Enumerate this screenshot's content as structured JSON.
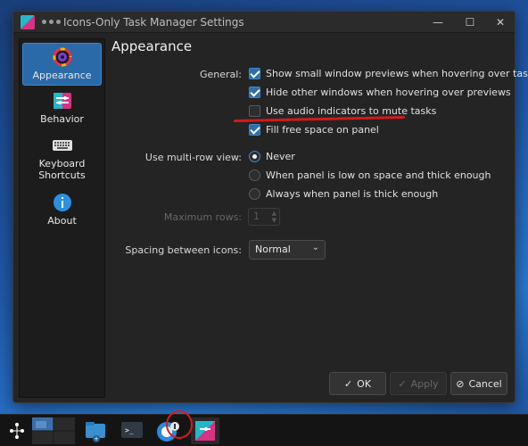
{
  "window": {
    "title": "Icons-Only Task Manager Settings",
    "minimize_glyph": "—",
    "maximize_glyph": "☐",
    "close_glyph": "✕"
  },
  "sidebar": {
    "items": [
      {
        "label": "Appearance",
        "icon": "appearance-icon",
        "active": true
      },
      {
        "label": "Behavior",
        "icon": "behavior-icon",
        "active": false
      },
      {
        "label": "Keyboard Shortcuts",
        "icon": "keyboard-icon",
        "active": false
      },
      {
        "label": "About",
        "icon": "info-icon",
        "active": false
      }
    ]
  },
  "content": {
    "title": "Appearance",
    "general_label": "General:",
    "general_options": [
      {
        "label": "Show small window previews when hovering over tasks",
        "checked": true
      },
      {
        "label": "Hide other windows when hovering over previews",
        "checked": true
      },
      {
        "label": "Use audio indicators to mute tasks",
        "checked": false
      },
      {
        "label": "Fill free space on panel",
        "checked": true
      }
    ],
    "multirow_label": "Use multi-row view:",
    "multirow_options": [
      {
        "label": "Never",
        "selected": true
      },
      {
        "label": "When panel is low on space and thick enough",
        "selected": false
      },
      {
        "label": "Always when panel is thick enough",
        "selected": false
      }
    ],
    "max_rows_label": "Maximum rows:",
    "max_rows_value": "1",
    "spacing_label": "Spacing between icons:",
    "spacing_value": "Normal"
  },
  "buttons": {
    "ok": "OK",
    "apply": "Apply",
    "cancel": "Cancel"
  },
  "colors": {
    "accent": "#2f6ea8",
    "annotation_red": "#d31a1a"
  }
}
